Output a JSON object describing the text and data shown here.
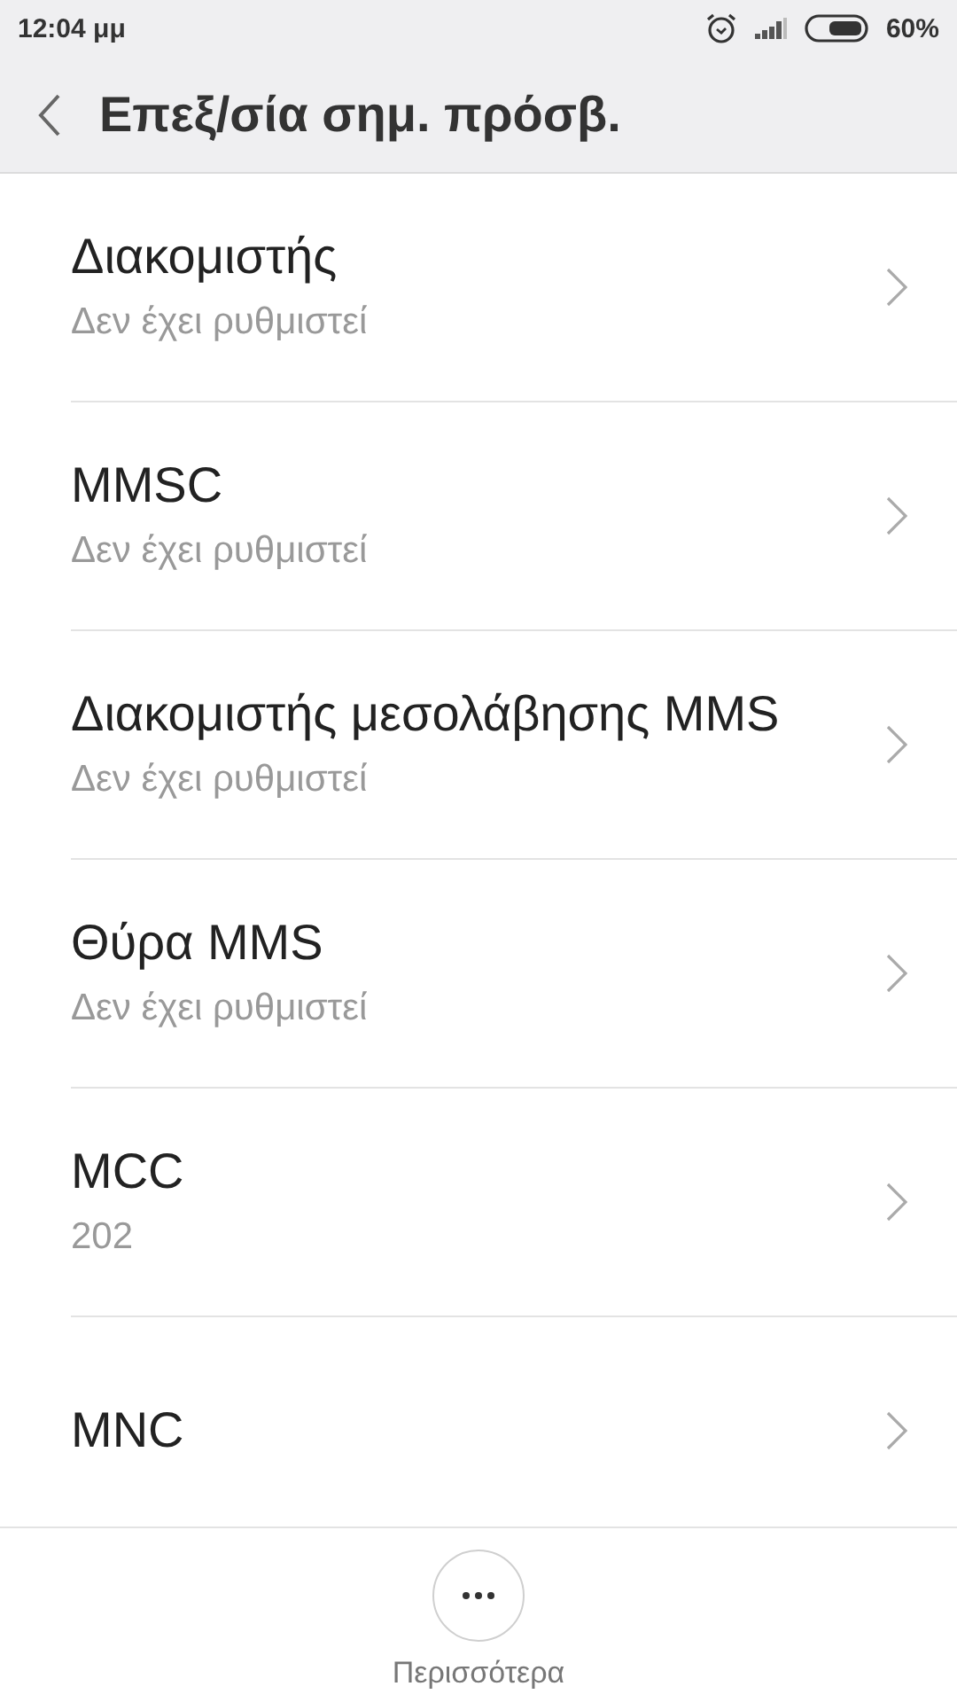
{
  "status_bar": {
    "time": "12:04 μμ",
    "battery": "60%"
  },
  "header": {
    "title": "Επεξ/σία σημ. πρόσβ."
  },
  "settings": [
    {
      "title": "Διακομιστής",
      "value": "Δεν έχει ρυθμιστεί"
    },
    {
      "title": "MMSC",
      "value": "Δεν έχει ρυθμιστεί"
    },
    {
      "title": "Διακομιστής μεσολάβησης MMS",
      "value": "Δεν έχει ρυθμιστεί"
    },
    {
      "title": "Θύρα MMS",
      "value": "Δεν έχει ρυθμιστεί"
    },
    {
      "title": "MCC",
      "value": "202"
    },
    {
      "title": "MNC"
    }
  ],
  "bottom_bar": {
    "more_label": "Περισσότερα"
  }
}
